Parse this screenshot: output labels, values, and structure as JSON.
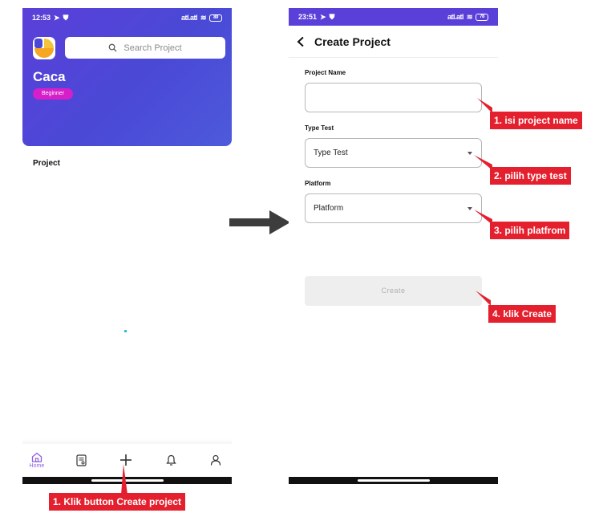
{
  "left_screen": {
    "status": {
      "time": "12:53",
      "signal": "atl.atl",
      "battery": "89"
    },
    "search": {
      "placeholder": "Search Project"
    },
    "user_name": "Caca",
    "level_badge": "Beginner",
    "section_title": "Project",
    "bottom_nav": {
      "home_label": "Home",
      "icons": [
        "home-icon",
        "document-icon",
        "plus-icon",
        "bell-icon",
        "user-icon"
      ]
    }
  },
  "right_screen": {
    "status": {
      "time": "23:51",
      "signal": "atl.atl",
      "battery": "78"
    },
    "title": "Create Project",
    "fields": {
      "project_name_label": "Project Name",
      "project_name_value": "",
      "type_test_label": "Type Test",
      "type_test_value": "Type Test",
      "platform_label": "Platform",
      "platform_value": "Platform"
    },
    "create_button": "Create"
  },
  "annotations": {
    "step1_left": "1. Klik button Create project",
    "step1_right": "1. isi project name",
    "step2": "2. pilih type test",
    "step3": "3. pilih platfrom",
    "step4": "4. klik Create"
  },
  "colors": {
    "header_purple": "#4a49d6",
    "badge_magenta": "#d61fc9",
    "annotation_red": "#e5202e",
    "loader_teal": "#2ec3c9"
  }
}
